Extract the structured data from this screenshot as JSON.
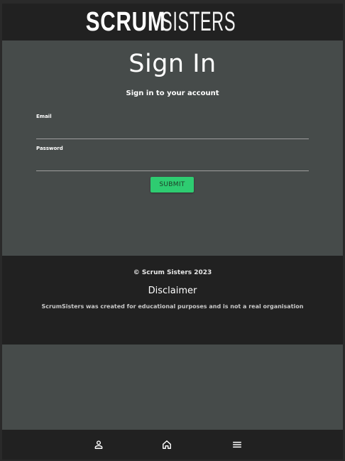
{
  "header": {
    "logo_bold": "SCRUM",
    "logo_light": "SISTERS"
  },
  "signin": {
    "title": "Sign In",
    "subtitle": "Sign in to your account",
    "email_label": "Email",
    "email_value": "",
    "password_label": "Password",
    "password_value": "",
    "submit_label": "SUBMIT"
  },
  "footer": {
    "copyright": "© Scrum Sisters 2023",
    "disclaimer_title": "Disclaimer",
    "disclaimer_text": "ScrumSisters was created for educational purposes and is not a real organisation"
  },
  "bottom_nav": {
    "items": [
      {
        "icon": "person-icon"
      },
      {
        "icon": "home-icon"
      },
      {
        "icon": "menu-icon"
      }
    ]
  },
  "colors": {
    "accent": "#2ecc71",
    "header_bg": "#212121",
    "page_bg": "#464b4a"
  }
}
